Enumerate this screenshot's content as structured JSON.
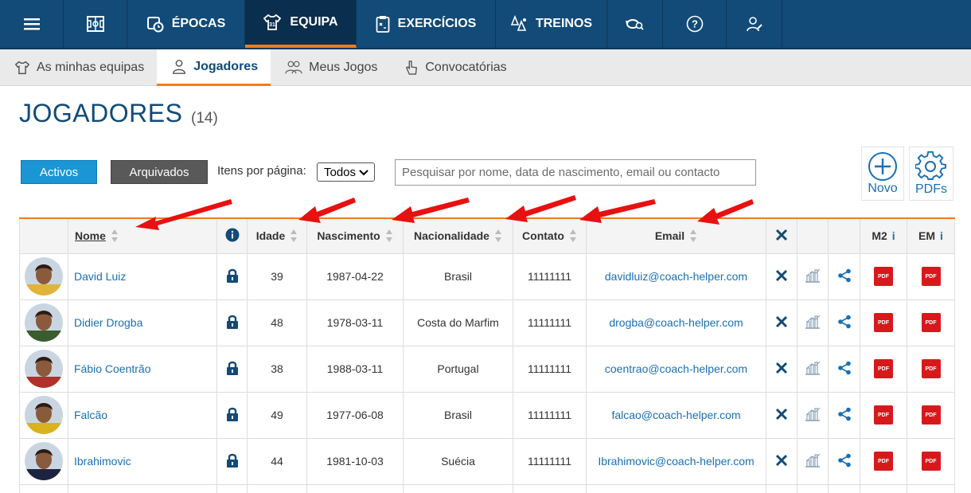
{
  "topnav": {
    "items": [
      {
        "label": "",
        "icon": "hamburger-menu-icon"
      },
      {
        "label": "",
        "icon": "board-icon"
      },
      {
        "label": "ÉPOCAS",
        "icon": "calendar-clock-icon"
      },
      {
        "label": "EQUIPA",
        "icon": "shirt-icon"
      },
      {
        "label": "EXERCÍCIOS",
        "icon": "clipboard-icon"
      },
      {
        "label": "TREINOS",
        "icon": "cones-icon"
      },
      {
        "label": "",
        "icon": "whistle-search-icon"
      },
      {
        "label": "",
        "icon": "help-icon"
      },
      {
        "label": "",
        "icon": "user-edit-icon"
      }
    ]
  },
  "subnav": {
    "items": [
      {
        "label": "As minhas equipas",
        "icon": "shirt-icon"
      },
      {
        "label": "Jogadores",
        "icon": "player-icon"
      },
      {
        "label": "Meus Jogos",
        "icon": "players-icon"
      },
      {
        "label": "Convocatórias",
        "icon": "hand-pointer-icon"
      }
    ]
  },
  "page": {
    "title": "JOGADORES",
    "count": "(14)"
  },
  "toolbar": {
    "activos": "Activos",
    "arquivados": "Arquivados",
    "items_label": "Itens por página:",
    "items_value": "Todos",
    "search_placeholder": "Pesquisar por nome, data de nascimento, email ou contacto",
    "novo": "Novo",
    "pdfs": "PDFs"
  },
  "table": {
    "headers": {
      "nome": "Nome",
      "idade": "Idade",
      "nascimento": "Nascimento",
      "nacionalidade": "Nacionalidade",
      "contato": "Contato",
      "email": "Email",
      "m2": "M2",
      "em": "EM",
      "info_i": "i"
    },
    "rows": [
      {
        "name": "David Luiz",
        "age": "39",
        "birth": "1987-04-22",
        "nationality": "Brasil",
        "contact": "11111111",
        "email": "davidluiz@coach-helper.com",
        "avatar_color": "#e0b43a"
      },
      {
        "name": "Didier Drogba",
        "age": "48",
        "birth": "1978-03-11",
        "nationality": "Costa do Marfim",
        "contact": "11111111",
        "email": "drogba@coach-helper.com",
        "avatar_color": "#3a5c2e"
      },
      {
        "name": "Fábio Coentrão",
        "age": "38",
        "birth": "1988-03-11",
        "nationality": "Portugal",
        "contact": "11111111",
        "email": "coentrao@coach-helper.com",
        "avatar_color": "#b0312b"
      },
      {
        "name": "Falcão",
        "age": "49",
        "birth": "1977-06-08",
        "nationality": "Brasil",
        "contact": "11111111",
        "email": "falcao@coach-helper.com",
        "avatar_color": "#d9b21e"
      },
      {
        "name": "Ibrahimovic",
        "age": "44",
        "birth": "1981-10-03",
        "nationality": "Suécia",
        "contact": "11111111",
        "email": "Ibrahimovic@coach-helper.com",
        "avatar_color": "#1c2340"
      }
    ],
    "pdf_label": "PDF"
  },
  "colors": {
    "nav_bg": "#124a78",
    "accent": "#f07c1b",
    "link": "#1a6fb3",
    "pdf_red": "#d7191c",
    "annotation_arrow": "#e81010"
  }
}
